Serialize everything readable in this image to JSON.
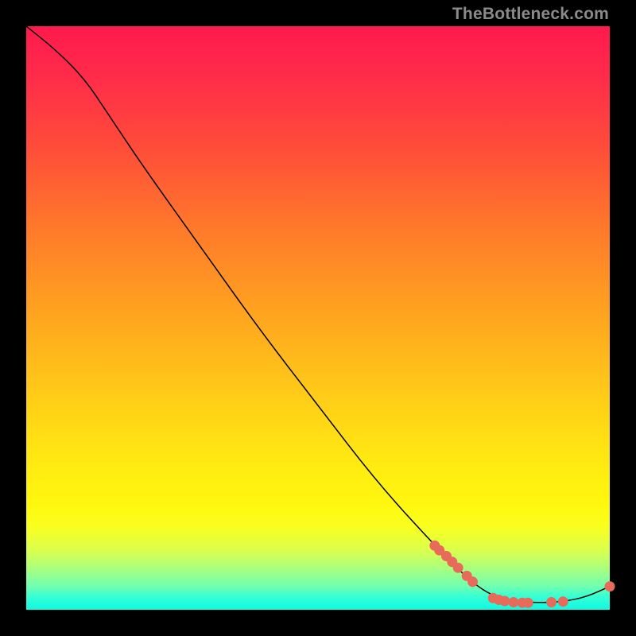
{
  "watermark": "TheBottleneck.com",
  "chart_data": {
    "type": "line",
    "title": "",
    "xlabel": "",
    "ylabel": "",
    "xlim": [
      0,
      100
    ],
    "ylim": [
      0,
      100
    ],
    "grid": false,
    "legend": false,
    "curve": [
      {
        "x": 0,
        "y": 100
      },
      {
        "x": 5,
        "y": 96
      },
      {
        "x": 10,
        "y": 91
      },
      {
        "x": 14,
        "y": 85
      },
      {
        "x": 20,
        "y": 76
      },
      {
        "x": 30,
        "y": 62
      },
      {
        "x": 40,
        "y": 48
      },
      {
        "x": 50,
        "y": 35
      },
      {
        "x": 60,
        "y": 22
      },
      {
        "x": 70,
        "y": 11
      },
      {
        "x": 77,
        "y": 4
      },
      {
        "x": 82,
        "y": 1.5
      },
      {
        "x": 88,
        "y": 1.2
      },
      {
        "x": 92,
        "y": 1.4
      },
      {
        "x": 96,
        "y": 2.2
      },
      {
        "x": 100,
        "y": 4
      }
    ],
    "highlight_points": [
      {
        "x": 70,
        "y": 11
      },
      {
        "x": 70.8,
        "y": 10.2
      },
      {
        "x": 72,
        "y": 9.2
      },
      {
        "x": 73,
        "y": 8.2
      },
      {
        "x": 74,
        "y": 7.2
      },
      {
        "x": 75.5,
        "y": 5.8
      },
      {
        "x": 76.5,
        "y": 4.8
      },
      {
        "x": 80,
        "y": 2
      },
      {
        "x": 81,
        "y": 1.7
      },
      {
        "x": 82,
        "y": 1.5
      },
      {
        "x": 83.5,
        "y": 1.3
      },
      {
        "x": 85,
        "y": 1.2
      },
      {
        "x": 86,
        "y": 1.2
      },
      {
        "x": 90,
        "y": 1.3
      },
      {
        "x": 92,
        "y": 1.4
      },
      {
        "x": 100,
        "y": 4
      }
    ],
    "colors": {
      "curve": "#000000",
      "dots": "#e86a5a",
      "gradient_top": "#ff1a4d",
      "gradient_bottom": "#10f8e0"
    }
  }
}
